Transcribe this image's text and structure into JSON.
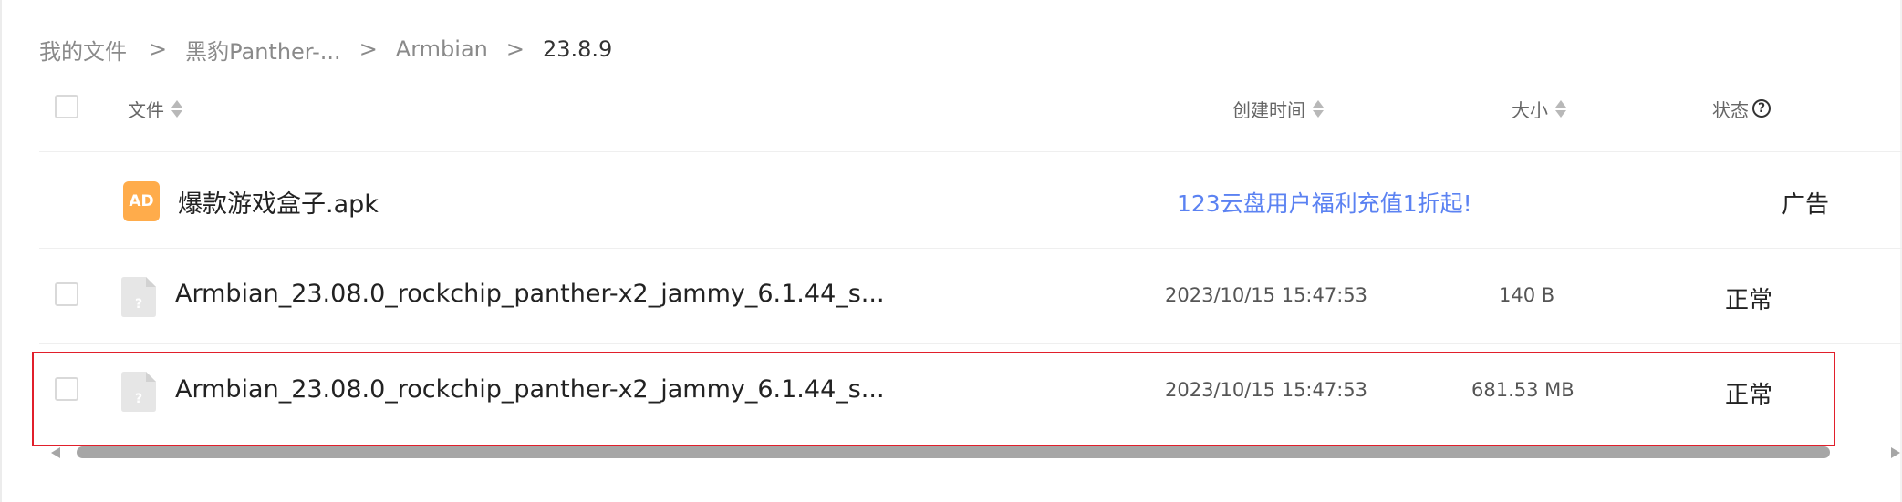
{
  "breadcrumb": {
    "items": [
      "我的文件",
      "黑豹Panther-...",
      "Armbian",
      "23.8.9"
    ],
    "separator": ">"
  },
  "columns": {
    "file": "文件",
    "created": "创建时间",
    "size": "大小",
    "status": "状态",
    "status_help": "?"
  },
  "ad_row": {
    "icon_text": "AD",
    "name": "爆款游戏盒子.apk",
    "link": "123云盘用户福利充值1折起!",
    "tag": "广告"
  },
  "files": [
    {
      "icon": "unknown-file-icon",
      "icon_text": "?",
      "name": "Armbian_23.08.0_rockchip_panther-x2_jammy_6.1.44_s...",
      "created": "2023/10/15 15:47:53",
      "size": "140 B",
      "status": "正常"
    },
    {
      "icon": "unknown-file-icon",
      "icon_text": "?",
      "name": "Armbian_23.08.0_rockchip_panther-x2_jammy_6.1.44_s...",
      "created": "2023/10/15 15:47:53",
      "size": "681.53 MB",
      "status": "正常"
    }
  ],
  "colors": {
    "accent_link": "#5b82f2",
    "ad_icon": "#ffac4b",
    "highlight": "#e11f2b",
    "file_icon": "#e6e6e6"
  }
}
